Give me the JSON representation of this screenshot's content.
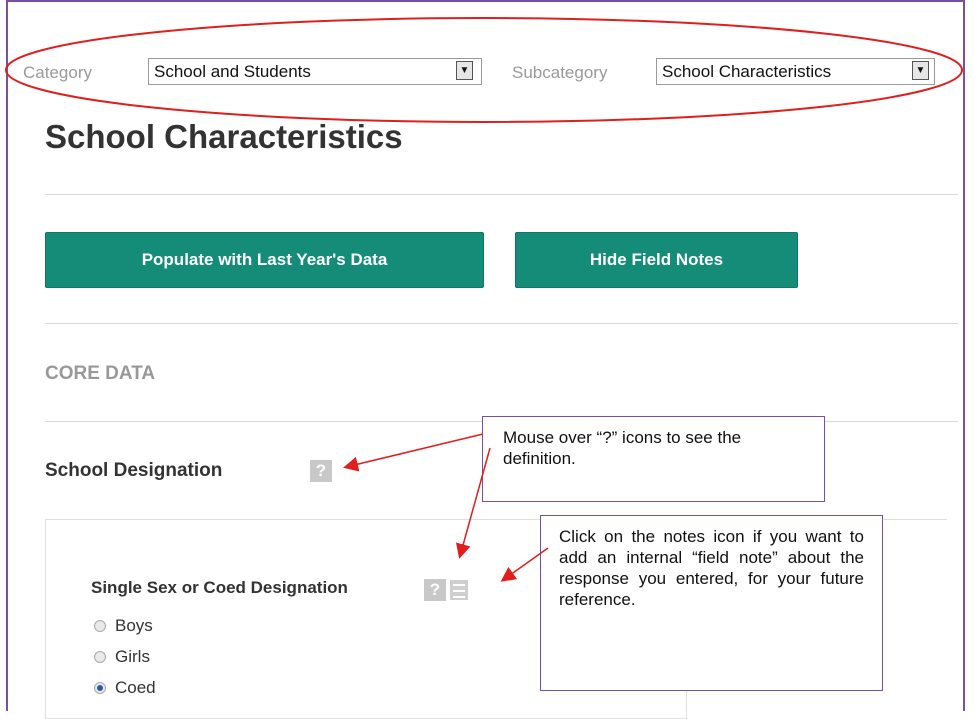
{
  "filters": {
    "category_label": "Category",
    "category_value": "School and Students",
    "subcategory_label": "Subcategory",
    "subcategory_value": "School Characteristics"
  },
  "page_title": "School Characteristics",
  "buttons": {
    "populate_label": "Populate with Last Year's Data",
    "hide_notes_label": "Hide Field Notes"
  },
  "section": {
    "core_label": "CORE DATA",
    "designation_title": "School Designation",
    "help_glyph": "?"
  },
  "question": {
    "label": "Single Sex or Coed Designation",
    "options": [
      "Boys",
      "Girls",
      "Coed"
    ],
    "selected": "Coed"
  },
  "callouts": {
    "help_tip": "Mouse over “?” icons to see the definition.",
    "notes_tip": "Click on the notes icon if you want to add an internal “field note” about the response you entered, for your future reference."
  },
  "colors": {
    "button_bg": "#158c78",
    "annotation_red": "#e01e1e",
    "frame_purple": "#7b4fa6"
  }
}
